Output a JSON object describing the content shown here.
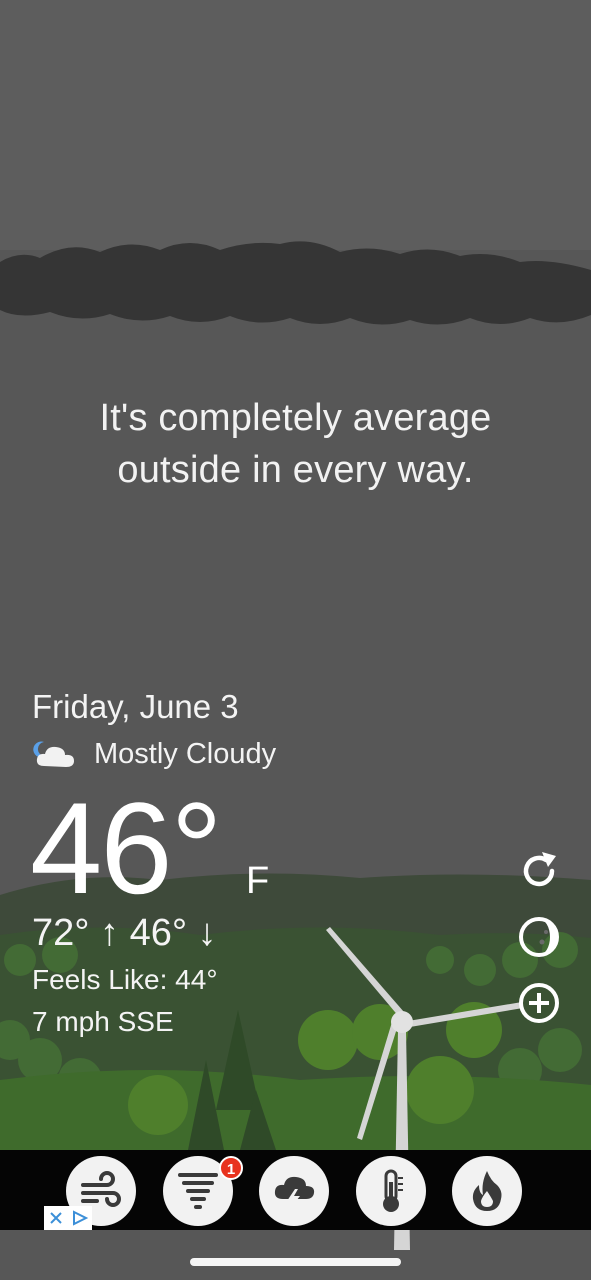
{
  "tagline": {
    "line1": "It's completely average",
    "line2": "outside in every way."
  },
  "weather": {
    "date": "Friday, June 3",
    "condition": "Mostly Cloudy",
    "condition_icon": "partly-cloudy-night-icon",
    "temperature": "46°",
    "unit": "F",
    "high_low": "72° ↑ 46° ↓",
    "feels_like": "Feels Like: 44°",
    "wind": "7 mph SSE"
  },
  "side_actions": [
    {
      "icon": "refresh-icon"
    },
    {
      "icon": "moon-phase-icon"
    },
    {
      "icon": "add-location-icon"
    }
  ],
  "toolbar": {
    "items": [
      {
        "icon": "wind-icon"
      },
      {
        "icon": "tornado-icon",
        "badge": "1"
      },
      {
        "icon": "thunderstorm-icon"
      },
      {
        "icon": "thermometer-icon"
      },
      {
        "icon": "fire-icon"
      }
    ]
  },
  "colors": {
    "sky": "#5a5a5a",
    "cloud_band": "#3a3a3a",
    "hills_dark": "#3b4a35",
    "grass": "#3f6b2c",
    "toolbar_bg": "#050505",
    "badge": "#e8321e"
  }
}
